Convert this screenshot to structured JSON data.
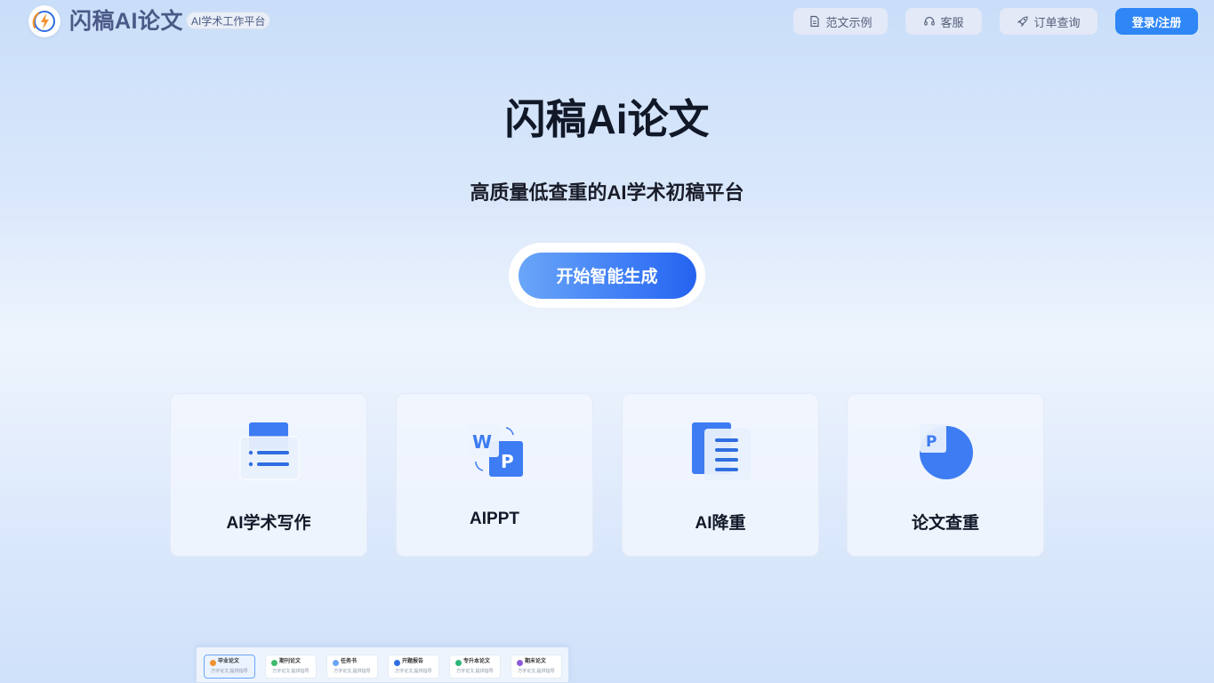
{
  "header": {
    "logo_text": "闪稿AI论文",
    "badge": "AI学术工作平台",
    "nav": [
      {
        "label": "范文示例",
        "icon": "document-icon"
      },
      {
        "label": "客服",
        "icon": "headset-icon"
      },
      {
        "label": "订单查询",
        "icon": "rocket-icon"
      }
    ],
    "login_label": "登录/注册"
  },
  "hero": {
    "title": "闪稿Ai论文",
    "subtitle": "高质量低查重的AI学术初稿平台",
    "cta_label": "开始智能生成"
  },
  "cards": [
    {
      "label": "AI学术写作",
      "icon": "writing-doc-icon"
    },
    {
      "label": "AIPPT",
      "icon": "word-to-ppt-icon"
    },
    {
      "label": "AI降重",
      "icon": "rewrite-doc-icon"
    },
    {
      "label": "论文查重",
      "icon": "pie-check-icon"
    }
  ],
  "strip": {
    "chips": [
      {
        "title": "毕业论文",
        "sub": "万字论文,提供指导",
        "color": "#f0922e",
        "active": true
      },
      {
        "title": "期刊论文",
        "sub": "万字论文,提供指导",
        "color": "#3dbb6a",
        "active": false
      },
      {
        "title": "任务书",
        "sub": "万字论文,提供指导",
        "color": "#6aa6f8",
        "active": false
      },
      {
        "title": "开题报告",
        "sub": "万字论文,提供指导",
        "color": "#2f6ee0",
        "active": false
      },
      {
        "title": "专升本论文",
        "sub": "万字论文,提供指导",
        "color": "#2fb67a",
        "active": false
      },
      {
        "title": "期末论文",
        "sub": "万字论文,提供指导",
        "color": "#8b5cd6",
        "active": false
      }
    ]
  },
  "colors": {
    "accent": "#2f86f6",
    "logo_text": "#4a5a86"
  }
}
